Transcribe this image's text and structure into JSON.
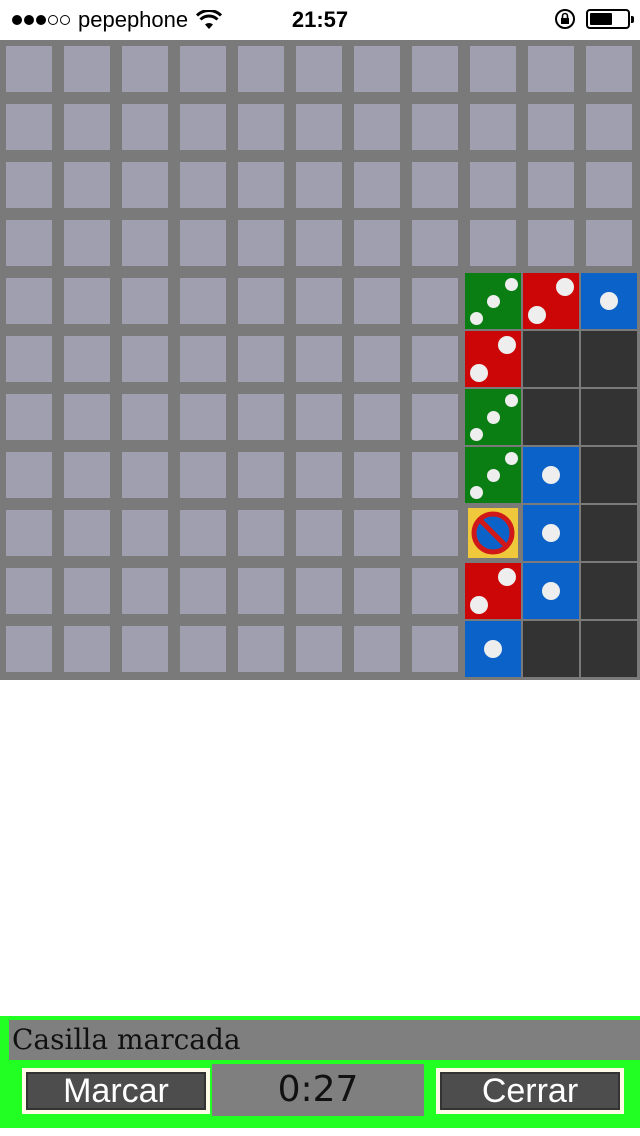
{
  "status_bar": {
    "carrier": "pepephone",
    "time": "21:57",
    "signal_bars_filled": 3,
    "signal_bars_total": 5,
    "battery_level": 0.6
  },
  "board": {
    "rows": 11,
    "cols": 11,
    "colors": {
      "background": "#7a7a7a",
      "empty": "#a09fb0",
      "dark": "#333333",
      "green": "#0a7d13",
      "red": "#cc0606",
      "blue": "#0b62c8",
      "blocked": "#f0c83c"
    },
    "special_cells": [
      {
        "row": 4,
        "col": 8,
        "type": "die",
        "color": "green",
        "value": 3
      },
      {
        "row": 4,
        "col": 9,
        "type": "die",
        "color": "red",
        "value": 2
      },
      {
        "row": 4,
        "col": 10,
        "type": "die",
        "color": "blue",
        "value": 1
      },
      {
        "row": 5,
        "col": 8,
        "type": "die",
        "color": "red",
        "value": 2
      },
      {
        "row": 5,
        "col": 9,
        "type": "dark"
      },
      {
        "row": 5,
        "col": 10,
        "type": "dark"
      },
      {
        "row": 6,
        "col": 8,
        "type": "die",
        "color": "green",
        "value": 3
      },
      {
        "row": 6,
        "col": 9,
        "type": "dark"
      },
      {
        "row": 6,
        "col": 10,
        "type": "dark"
      },
      {
        "row": 7,
        "col": 8,
        "type": "die",
        "color": "green",
        "value": 3
      },
      {
        "row": 7,
        "col": 9,
        "type": "die",
        "color": "blue",
        "value": 1
      },
      {
        "row": 7,
        "col": 10,
        "type": "dark"
      },
      {
        "row": 8,
        "col": 8,
        "type": "blocked",
        "icon": "no-parking-icon"
      },
      {
        "row": 8,
        "col": 9,
        "type": "die",
        "color": "blue",
        "value": 1
      },
      {
        "row": 8,
        "col": 10,
        "type": "dark"
      },
      {
        "row": 9,
        "col": 8,
        "type": "die",
        "color": "red",
        "value": 2
      },
      {
        "row": 9,
        "col": 9,
        "type": "die",
        "color": "blue",
        "value": 1
      },
      {
        "row": 9,
        "col": 10,
        "type": "dark"
      },
      {
        "row": 10,
        "col": 8,
        "type": "die",
        "color": "blue",
        "value": 1
      },
      {
        "row": 10,
        "col": 9,
        "type": "dark"
      },
      {
        "row": 10,
        "col": 10,
        "type": "dark"
      }
    ]
  },
  "bottom_panel": {
    "message": "Casilla marcada",
    "mark_label": "Marcar",
    "timer": "0:27",
    "close_label": "Cerrar",
    "accent_color": "#22ff22"
  }
}
